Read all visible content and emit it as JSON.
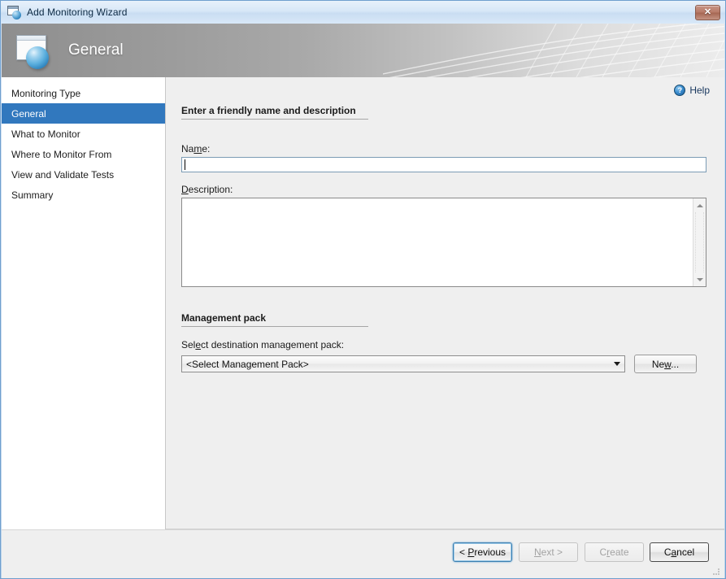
{
  "window": {
    "title": "Add Monitoring Wizard",
    "close_label": "✕",
    "icon": "wizard-window-icon"
  },
  "banner": {
    "title": "General",
    "icon": "wizard-window-sphere-icon"
  },
  "sidebar": {
    "items": [
      {
        "label": "Monitoring Type",
        "selected": false
      },
      {
        "label": "General",
        "selected": true
      },
      {
        "label": "What to Monitor",
        "selected": false
      },
      {
        "label": "Where to Monitor From",
        "selected": false
      },
      {
        "label": "View and Validate Tests",
        "selected": false
      },
      {
        "label": "Summary",
        "selected": false
      }
    ]
  },
  "help": {
    "label": "Help",
    "icon_glyph": "?"
  },
  "main": {
    "section1_heading": "Enter a friendly name and description",
    "name_label_pre": "Na",
    "name_label_acc": "m",
    "name_label_post": "e:",
    "name_value": "",
    "description_label_acc": "D",
    "description_label_post": "escription:",
    "description_value": "",
    "section2_heading": "Management pack",
    "mp_label_pre": "Sel",
    "mp_label_acc": "e",
    "mp_label_post": "ct destination management pack:",
    "mp_selected": "<Select Management Pack>",
    "mp_options": [
      "<Select Management Pack>"
    ],
    "new_button_pre": "Ne",
    "new_button_acc": "w",
    "new_button_post": "..."
  },
  "footer": {
    "previous_pre": "< ",
    "previous_acc": "P",
    "previous_post": "revious",
    "next_acc": "N",
    "next_post": "ext >",
    "create_pre": "C",
    "create_acc": "r",
    "create_post": "eate",
    "cancel_pre": "C",
    "cancel_acc": "a",
    "cancel_post": "ncel"
  },
  "colors": {
    "selection_blue": "#3178be",
    "help_text": "#17365d",
    "close_button": "#b87b68",
    "window_border": "#6f9fce"
  }
}
